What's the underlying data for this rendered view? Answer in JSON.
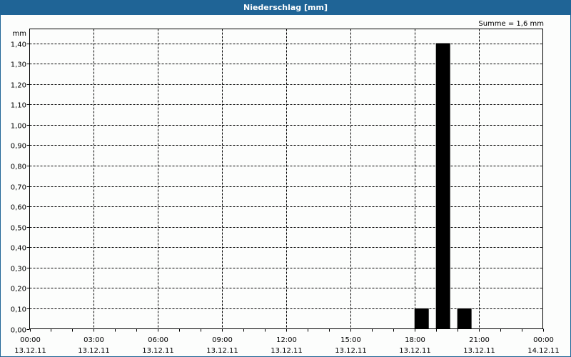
{
  "window": {
    "title": "Niederschlag [mm]"
  },
  "chart_data": {
    "type": "bar",
    "title": "Niederschlag [mm]",
    "annotation": "Summe = 1,6 mm",
    "ylabel": "mm",
    "xlabel": "",
    "ylim": [
      0,
      1.47
    ],
    "xlim_hours": [
      0,
      24
    ],
    "grid": true,
    "y_ticks": [
      0,
      0.1,
      0.2,
      0.3,
      0.4,
      0.5,
      0.6,
      0.7,
      0.8,
      0.9,
      1.0,
      1.1,
      1.2,
      1.3,
      1.4
    ],
    "y_tick_labels": [
      "0,00",
      "0,10",
      "0,20",
      "0,30",
      "0,40",
      "0,50",
      "0,60",
      "0,70",
      "0,80",
      "0,90",
      "1,00",
      "1,10",
      "1,20",
      "1,30",
      "1,40"
    ],
    "x_ticks": [
      {
        "hour": 0,
        "time": "00:00",
        "date": "13.12.11"
      },
      {
        "hour": 3,
        "time": "03:00",
        "date": "13.12.11"
      },
      {
        "hour": 6,
        "time": "06:00",
        "date": "13.12.11"
      },
      {
        "hour": 9,
        "time": "09:00",
        "date": "13.12.11"
      },
      {
        "hour": 12,
        "time": "12:00",
        "date": "13.12.11"
      },
      {
        "hour": 15,
        "time": "15:00",
        "date": "13.12.11"
      },
      {
        "hour": 18,
        "time": "18:00",
        "date": "13.12.11"
      },
      {
        "hour": 21,
        "time": "21:00",
        "date": "13.12.11"
      },
      {
        "hour": 24,
        "time": "00:00",
        "date": "14.12.11"
      }
    ],
    "bars": [
      {
        "hour": 18,
        "value": 0.1
      },
      {
        "hour": 19,
        "value": 1.4
      },
      {
        "hour": 20,
        "value": 0.1
      }
    ],
    "bar_color": "#000000"
  }
}
